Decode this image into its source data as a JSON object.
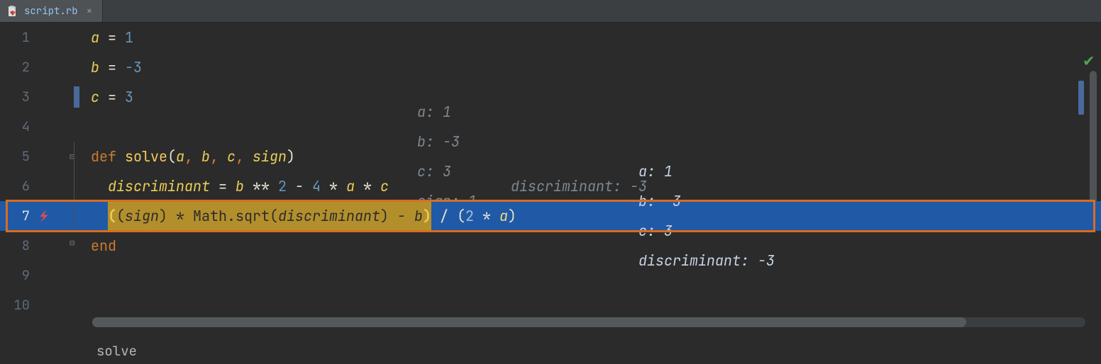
{
  "tab": {
    "filename": "script.rb"
  },
  "gutter": {
    "lines": [
      "1",
      "2",
      "3",
      "4",
      "5",
      "6",
      "7",
      "8",
      "9",
      "10"
    ]
  },
  "code": {
    "l1": {
      "var": "a",
      "eq": " = ",
      "val": "1"
    },
    "l2": {
      "var": "b",
      "eq": " = ",
      "val": "-3"
    },
    "l3": {
      "var": "c",
      "eq": " = ",
      "val": "3"
    },
    "l5": {
      "kw": "def ",
      "fn": "solve",
      "open": "(",
      "a": "a",
      "c1": ", ",
      "b": "b",
      "c2": ", ",
      "c": "c",
      "c3": ", ",
      "s": "sign",
      "close": ")"
    },
    "l6": {
      "d": "discriminant",
      "eq": " = ",
      "b": "b",
      "pow": " ** ",
      "two": "2",
      "minus": " - ",
      "four": "4",
      "mul1": " * ",
      "a": "a",
      "mul2": " * ",
      "c": "c"
    },
    "l7": {
      "op_outer": "(",
      "op_inner": "(",
      "sign": "sign",
      "cp_inner": ")",
      "mul": " * ",
      "math": "Math",
      "dot": ".",
      "sqrt": "sqrt",
      "sp": "(",
      "disc": "discriminant",
      "spc": ")",
      "minus": " - ",
      "b": "b",
      "cp_outer": ")",
      "div": " / ",
      "dp": "(",
      "two": "2",
      "mul2": " * ",
      "a": "a",
      "dpc": ")"
    },
    "l8": {
      "kw": "end"
    }
  },
  "inlays": {
    "l5": [
      {
        "k": "a",
        "v": "1"
      },
      {
        "k": "b",
        "v": "-3"
      },
      {
        "k": "c",
        "v": "3"
      },
      {
        "k": "sign",
        "v": "1"
      }
    ],
    "l6": [
      {
        "k": "discriminant",
        "v": "-3"
      }
    ],
    "l7": [
      {
        "k": "a",
        "v": "1"
      },
      {
        "k": "b",
        "v": "-3"
      },
      {
        "k": "c",
        "v": "3"
      },
      {
        "k": "discriminant",
        "v": "-3"
      }
    ]
  },
  "breadcrumb": {
    "item": "solve"
  }
}
